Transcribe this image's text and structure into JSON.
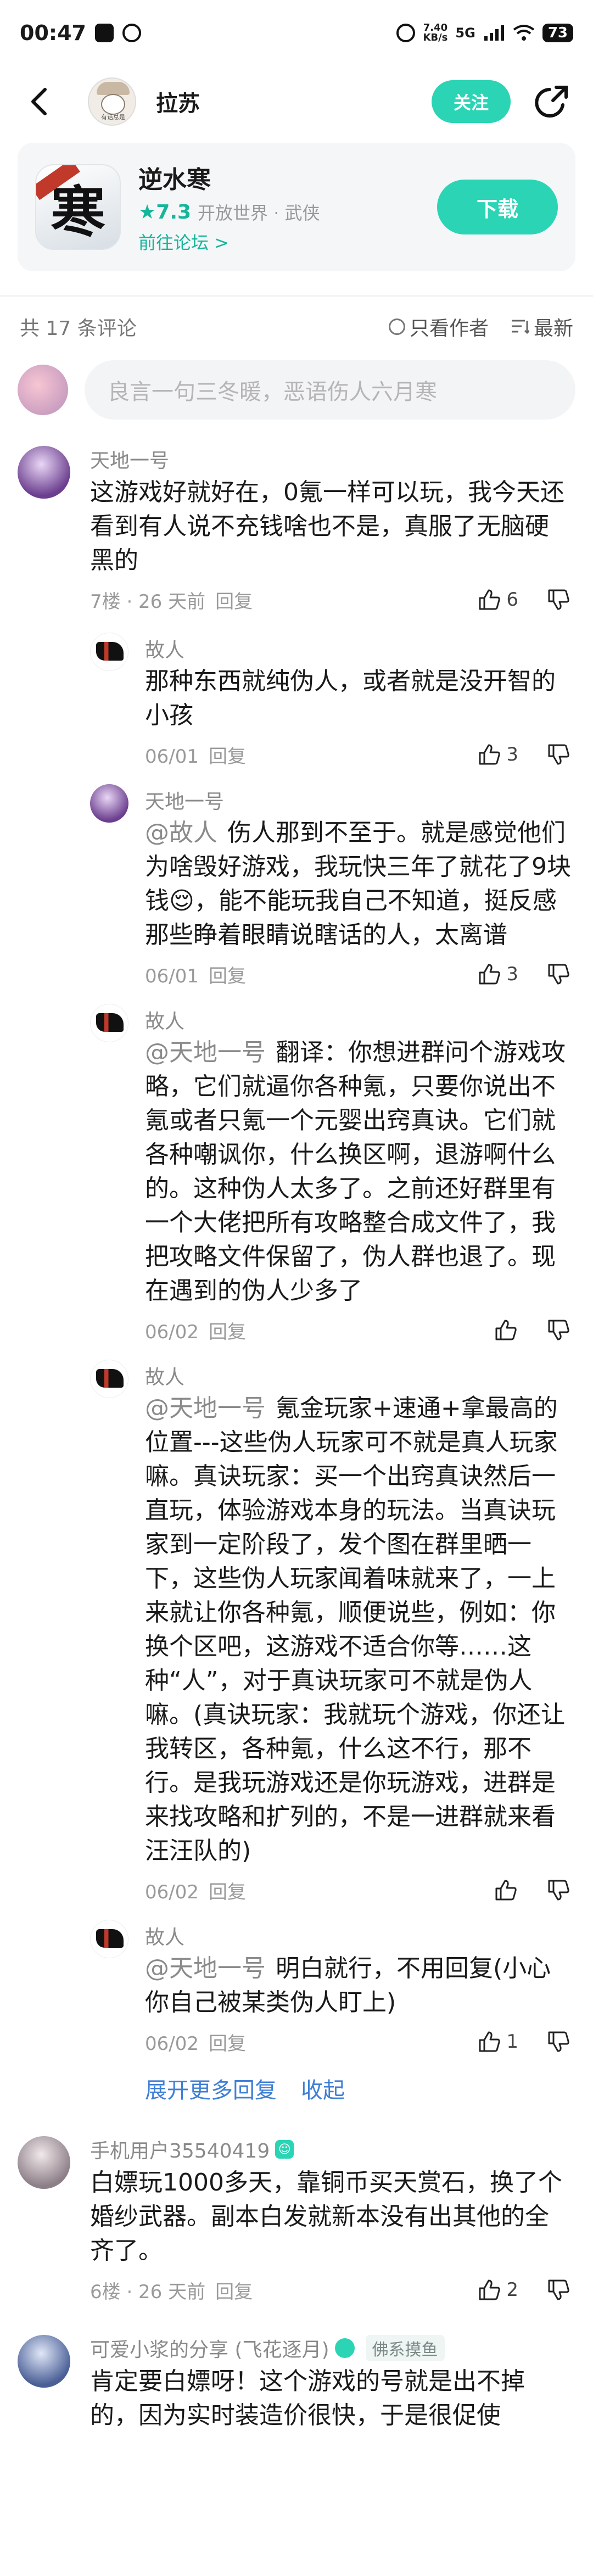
{
  "status_bar": {
    "time": "00:47",
    "net_speed_value": "7.40",
    "net_speed_unit": "KB/s",
    "network": "5G",
    "battery": "73"
  },
  "header": {
    "author_name": "拉苏",
    "avatar_tag": "有话总是",
    "follow_label": "关注"
  },
  "game": {
    "icon_glyph": "寒",
    "title": "逆水寒",
    "rating": "★7.3",
    "tags": "开放世界 · 武侠",
    "forum_link": "前往论坛 >",
    "download_label": "下载"
  },
  "comments_bar": {
    "count": "共 17 条评论",
    "author_only": "只看作者",
    "sort": "最新"
  },
  "input": {
    "placeholder": "良言一句三冬暖，恶语伤人六月寒"
  },
  "comments": [
    {
      "name": "天地一号",
      "text": "这游戏好就好在，0氪一样可以玩，我今天还看到有人说不充钱啥也不是，真服了无脑硬黑的",
      "meta": "7楼 · 26 天前",
      "reply": "回复",
      "likes": "6",
      "replies": [
        {
          "name": "故人",
          "at": "",
          "text": "那种东西就纯伪人，或者就是没开智的小孩",
          "date": "06/01",
          "reply": "回复",
          "likes": "3"
        },
        {
          "name": "天地一号",
          "at": "@故人",
          "text": "伤人那到不至于。就是感觉他们为啥毁好游戏，我玩快三年了就花了9块钱😌，能不能玩我自己不知道，挺反感那些睁着眼睛说瞎话的人，太离谱",
          "date": "06/01",
          "reply": "回复",
          "likes": "3"
        },
        {
          "name": "故人",
          "at": "@天地一号",
          "text": "翻译：你想进群问个游戏攻略，它们就逼你各种氪，只要你说出不氪或者只氪一个元婴出窍真诀。它们就各种嘲讽你，什么换区啊，退游啊什么的。这种伪人太多了。之前还好群里有一个大佬把所有攻略整合成文件了，我把攻略文件保留了，伪人群也退了。现在遇到的伪人少多了",
          "date": "06/02",
          "reply": "回复",
          "likes": ""
        },
        {
          "name": "故人",
          "at": "@天地一号",
          "text": "氪金玩家+速通+拿最高的位置---这些伪人玩家可不就是真人玩家嘛。真诀玩家：买一个出窍真诀然后一直玩，体验游戏本身的玩法。当真诀玩家到一定阶段了，发个图在群里晒一下，这些伪人玩家闻着味就来了，一上来就让你各种氪，顺便说些，例如：你换个区吧，这游戏不适合你等……这种“人”，对于真诀玩家可不就是伪人嘛。(真诀玩家：我就玩个游戏，你还让我转区，各种氪，什么这不行，那不行。是我玩游戏还是你玩游戏，进群是来找攻略和扩列的，不是一进群就来看汪汪队的)",
          "date": "06/02",
          "reply": "回复",
          "likes": ""
        },
        {
          "name": "故人",
          "at": "@天地一号",
          "text": "明白就行，不用回复(小心你自己被某类伪人盯上)",
          "date": "06/02",
          "reply": "回复",
          "likes": "1"
        }
      ],
      "expand_more": "展开更多回复",
      "collapse": "收起"
    },
    {
      "name": "手机用户35540419",
      "text": "白嫖玩1000多天，靠铜币买天赏石，换了个婚纱武器。副本白发就新本没有出其他的全齐了。",
      "meta": "6楼 · 26 天前",
      "reply": "回复",
      "likes": "2"
    },
    {
      "name": "可爱小浆的分享 (飞花逐月)",
      "tag": "佛系摸鱼",
      "text": "肯定要白嫖呀！这个游戏的号就是出不掉的，因为实时装造价很快，于是很促使",
      "meta": "",
      "reply": "",
      "likes": ""
    }
  ]
}
